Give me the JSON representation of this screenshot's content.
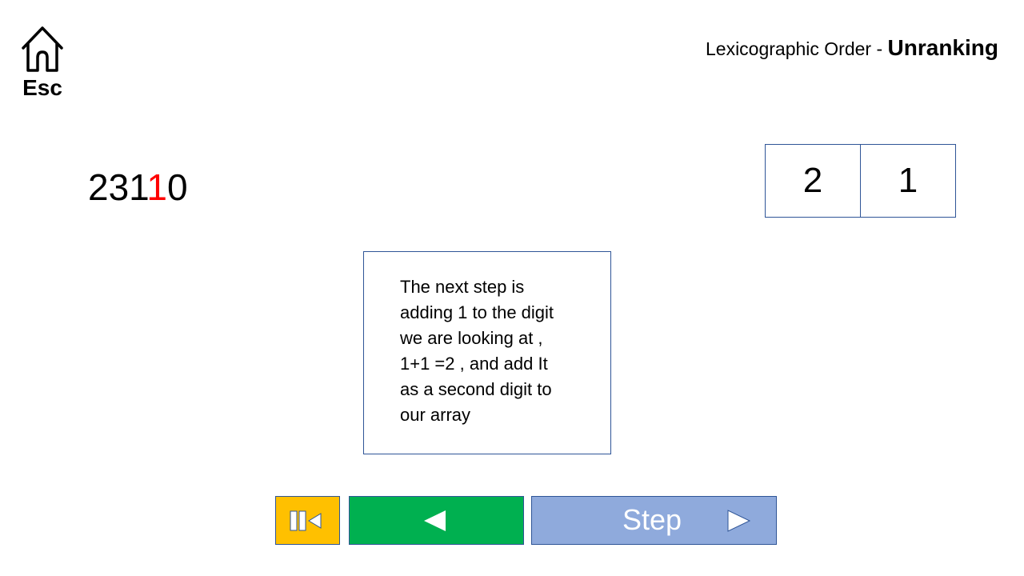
{
  "home": {
    "label": "Esc",
    "icon": "home-icon"
  },
  "title": {
    "prefix": "Lexicographic Order - ",
    "bold": "Unranking"
  },
  "number": {
    "digits_before": "231",
    "digit_current": "1",
    "digits_after": "0",
    "highlight_color": "#ff0000"
  },
  "array": {
    "cells": [
      "2",
      "1"
    ]
  },
  "explanation": {
    "lines": [
      "The next step is",
      "adding 1 to the digit",
      "we are looking at ,",
      "1+1 =2 , and add It",
      "as a second digit to",
      "our array"
    ]
  },
  "controls": {
    "restart": {
      "icon": "restart-icon",
      "color": "#ffc000"
    },
    "back": {
      "icon": "back-arrow-icon",
      "color": "#00b050"
    },
    "step": {
      "label": "Step",
      "icon": "play-arrow-icon",
      "color": "#8faadc"
    }
  }
}
